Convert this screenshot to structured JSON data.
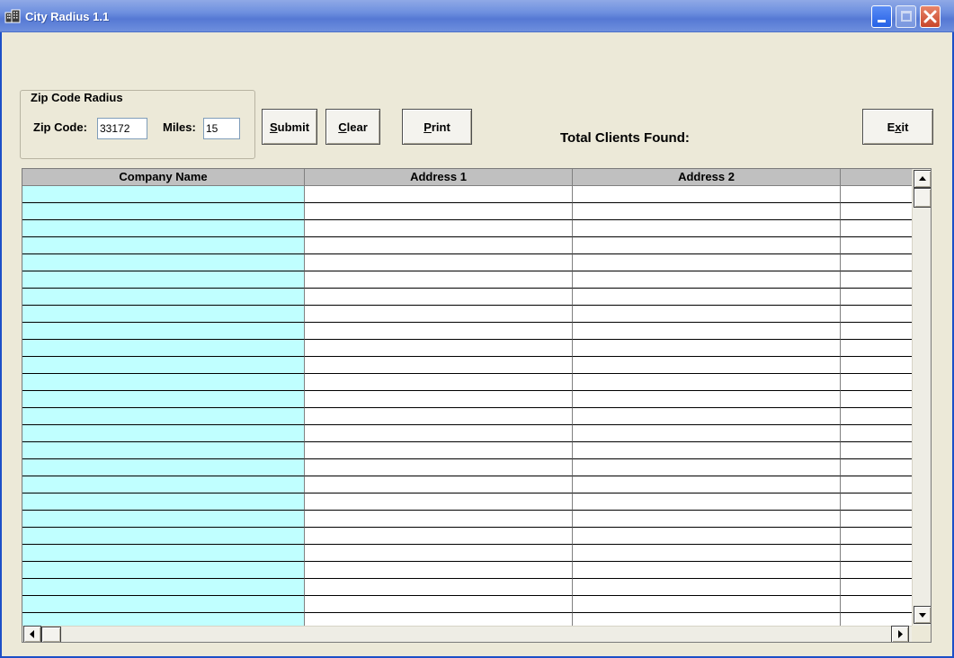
{
  "window": {
    "title": "City Radius  1.1",
    "icon": "building-icon"
  },
  "group": {
    "legend": "Zip Code Radius",
    "zip_label": "Zip Code:",
    "zip_value": "33172",
    "miles_label": "Miles:",
    "miles_value": "15"
  },
  "buttons": {
    "submit": {
      "label": "Submit",
      "accel": "S",
      "rest": "ubmit"
    },
    "clear": {
      "label": "Clear",
      "accel": "C",
      "rest": "lear"
    },
    "print": {
      "label": "Print",
      "accel": "P",
      "rest": "rint"
    },
    "exit": {
      "label": "Exit",
      "pre": "E",
      "accel": "x",
      "rest": "it"
    }
  },
  "total_clients_label": "Total Clients Found:",
  "grid": {
    "columns": [
      "Company Name",
      "Address 1",
      "Address 2",
      ""
    ],
    "rows": [
      [
        "",
        "",
        "",
        ""
      ],
      [
        "",
        "",
        "",
        ""
      ],
      [
        "",
        "",
        "",
        ""
      ],
      [
        "",
        "",
        "",
        ""
      ],
      [
        "",
        "",
        "",
        ""
      ],
      [
        "",
        "",
        "",
        ""
      ],
      [
        "",
        "",
        "",
        ""
      ],
      [
        "",
        "",
        "",
        ""
      ],
      [
        "",
        "",
        "",
        ""
      ],
      [
        "",
        "",
        "",
        ""
      ],
      [
        "",
        "",
        "",
        ""
      ],
      [
        "",
        "",
        "",
        ""
      ],
      [
        "",
        "",
        "",
        ""
      ],
      [
        "",
        "",
        "",
        ""
      ],
      [
        "",
        "",
        "",
        ""
      ],
      [
        "",
        "",
        "",
        ""
      ],
      [
        "",
        "",
        "",
        ""
      ],
      [
        "",
        "",
        "",
        ""
      ],
      [
        "",
        "",
        "",
        ""
      ],
      [
        "",
        "",
        "",
        ""
      ],
      [
        "",
        "",
        "",
        ""
      ],
      [
        "",
        "",
        "",
        ""
      ],
      [
        "",
        "",
        "",
        ""
      ],
      [
        "",
        "",
        "",
        ""
      ],
      [
        "",
        "",
        "",
        ""
      ],
      [
        "",
        "",
        "",
        ""
      ]
    ],
    "first_column_color": "#c0ffff"
  },
  "colors": {
    "window_bg": "#ece9d8",
    "titlebar": "#6d8fdf"
  }
}
